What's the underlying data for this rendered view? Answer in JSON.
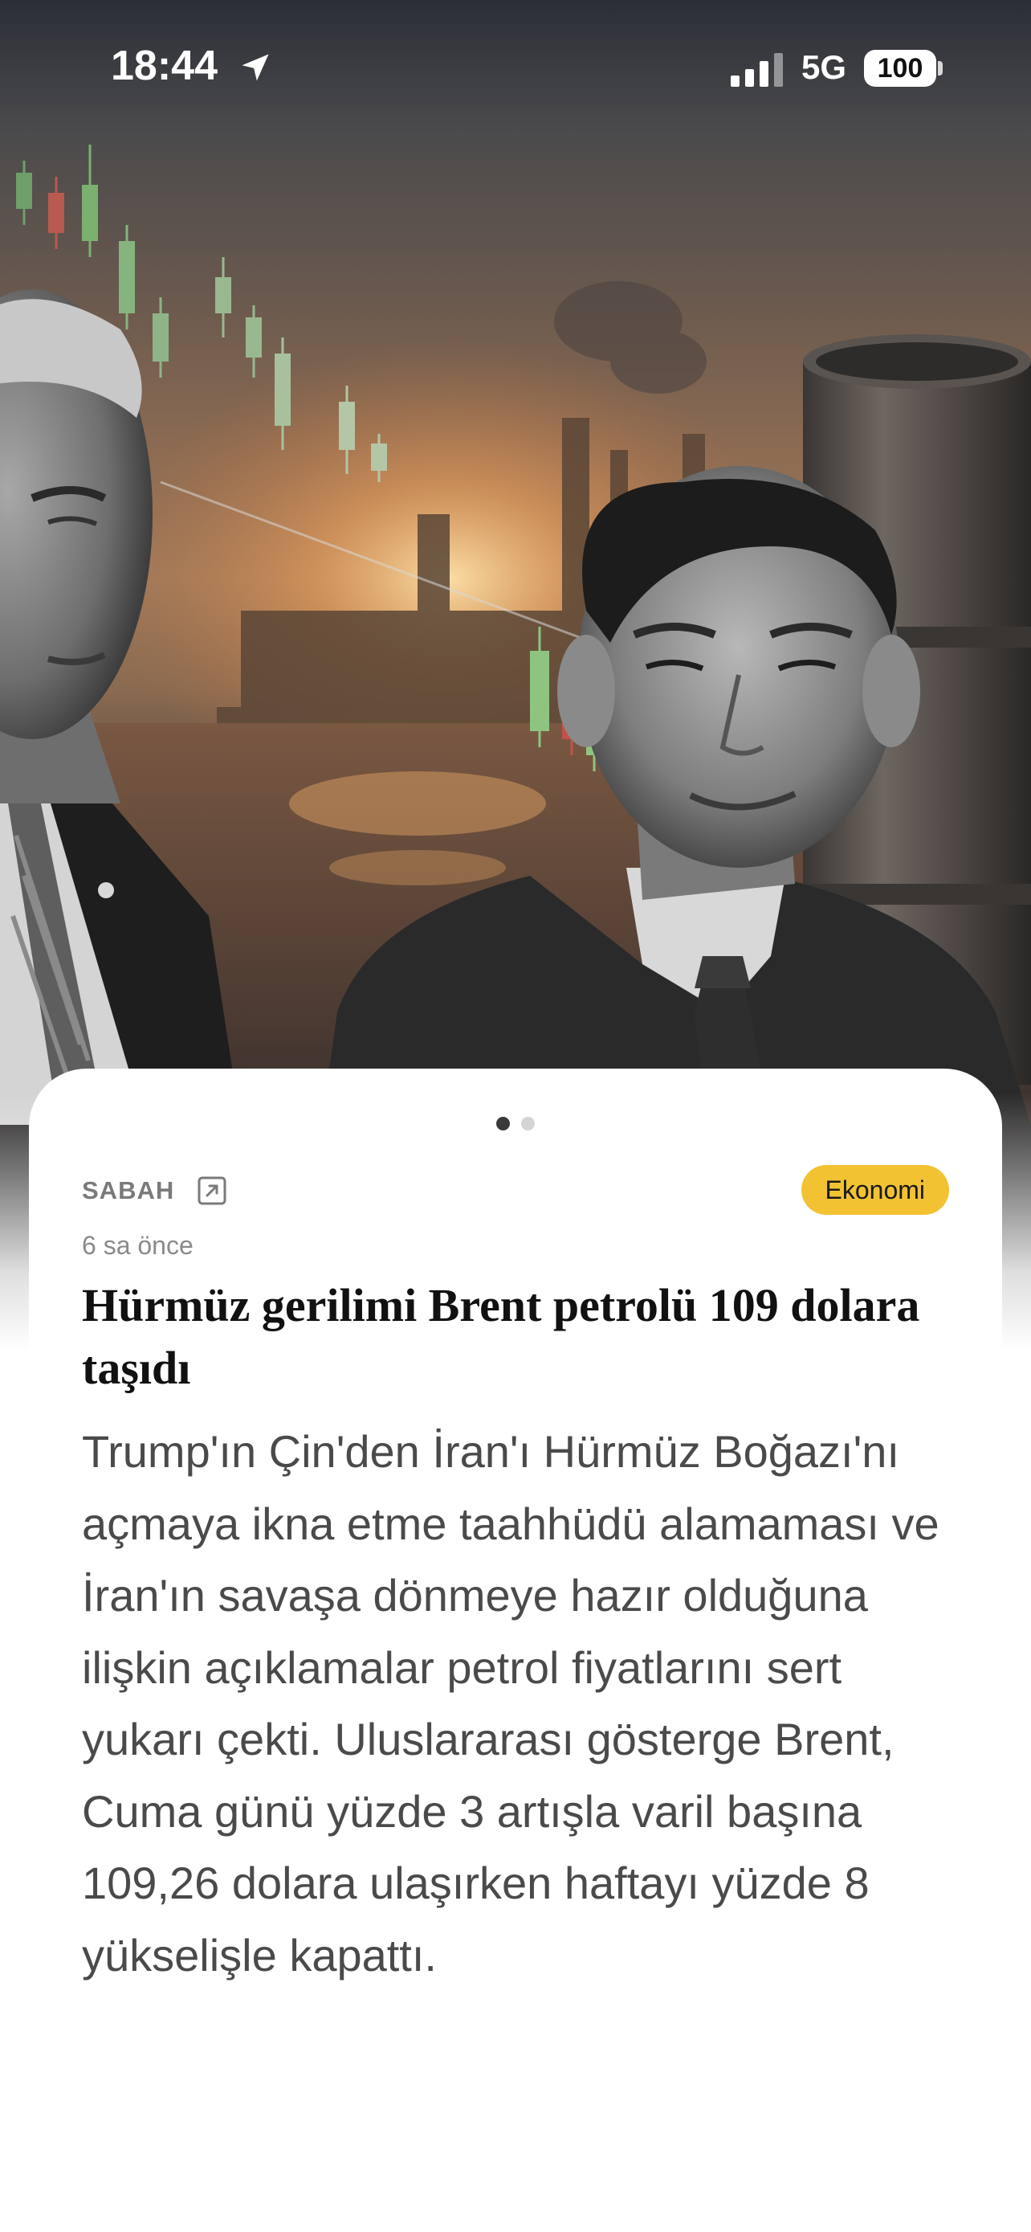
{
  "status_bar": {
    "time": "18:44",
    "network": "5G",
    "battery": "100",
    "location_icon": "location-arrow-icon",
    "signal_icon": "cellular-signal-icon"
  },
  "hero": {
    "image_description_icon": "article-hero-image"
  },
  "pager": {
    "total": 2,
    "active_index": 0
  },
  "article": {
    "source": "SABAH",
    "source_link_icon": "external-link-icon",
    "category": "Ekonomi",
    "timestamp": "6 sa önce",
    "headline": "Hürmüz gerilimi Brent petrolü 109 dolara taşıdı",
    "summary": "Trump'ın Çin'den İran'ı Hürmüz Boğazı'nı açmaya ikna etme taahhüdü alamaması ve İran'ın savaşa dönmeye hazır olduğuna ilişkin açıklamalar petrol fiyatlarını sert yukarı çekti. Uluslararası gösterge Brent, Cuma günü yüzde 3 artışla varil başına 109,26 dolara ulaşırken haftayı yüzde 8 yükselişle kapattı."
  },
  "colors": {
    "badge": "#f2c233",
    "source_text": "#7a7a7a",
    "headline": "#111111",
    "summary": "#4a4a4a",
    "dot_active": "#3a3a3a",
    "dot_inactive": "#d4d4d4"
  }
}
